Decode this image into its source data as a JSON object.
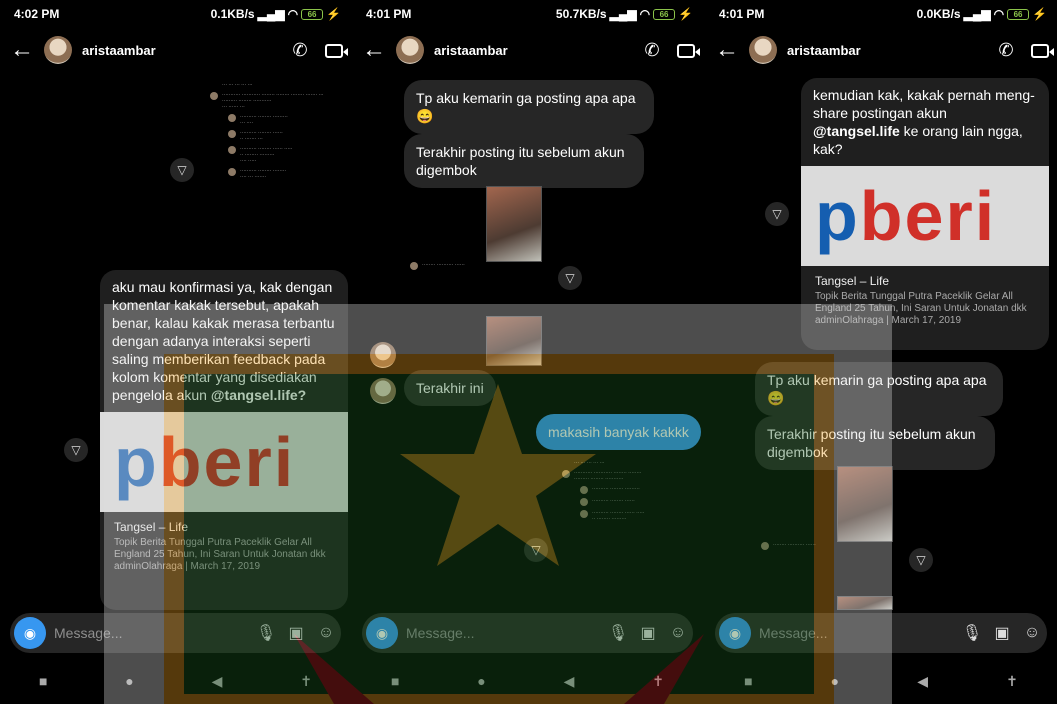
{
  "panels": [
    {
      "time": "4:02 PM",
      "net": "0.1KB/s",
      "battery": "66",
      "username": "aristaambar",
      "bubble_text": "aku mau konfirmasi ya, kak dengan komentar kakak tersebut, apakah benar, kalau kakak merasa terbantu dengan adanya interaksi seperti saling memberikan feedback pada kolom komentar yang disediakan pengelola akun ",
      "mention": "@tangsel.life?",
      "card_title": "Tangsel – Life",
      "card_sub": "Topik Berita Tunggal Putra Paceklik Gelar All England 25 Tahun, Ini Saran Untuk Jonatan dkk adminOlahraga | March 17, 2019",
      "placeholder": "Message..."
    },
    {
      "time": "4:01 PM",
      "net": "50.7KB/s",
      "battery": "66",
      "username": "aristaambar",
      "msg1": "Tp aku kemarin ga posting apa apa 😄",
      "msg2": "Terakhir posting itu sebelum akun digembok",
      "msg3": "Terakhir ini",
      "msg4": "makasih banyak kakkk",
      "placeholder": "Message..."
    },
    {
      "time": "4:01 PM",
      "net": "0.0KB/s",
      "battery": "66",
      "username": "aristaambar",
      "card_text": "kemudian kak, kakak pernah meng-share postingan akun ",
      "card_mention": "@tangsel.life",
      "card_text2": " ke orang lain ngga, kak?",
      "card_title": "Tangsel – Life",
      "card_sub": "Topik Berita Tunggal Putra Paceklik Gelar All England 25 Tahun, Ini Saran Untuk Jonatan dkk adminOlahraga | March 17, 2019",
      "msg1": "Tp aku kemarin ga posting apa apa 😄",
      "msg2": "Terakhir posting itu sebelum akun digembok",
      "placeholder": "Message..."
    }
  ],
  "logo_text": "beri",
  "logo_p": "p",
  "icons": {
    "back": "←",
    "call": "✆",
    "forward": "▽",
    "camera": "◉",
    "mic": "🎙",
    "gallery": "▣",
    "sticker": "☺",
    "nav_square": "■",
    "nav_home": "●",
    "nav_back": "◀",
    "nav_access": "✝"
  },
  "colors": {
    "accent": "#3797f0",
    "bubble": "#262626",
    "battery": "#8bc34a"
  }
}
